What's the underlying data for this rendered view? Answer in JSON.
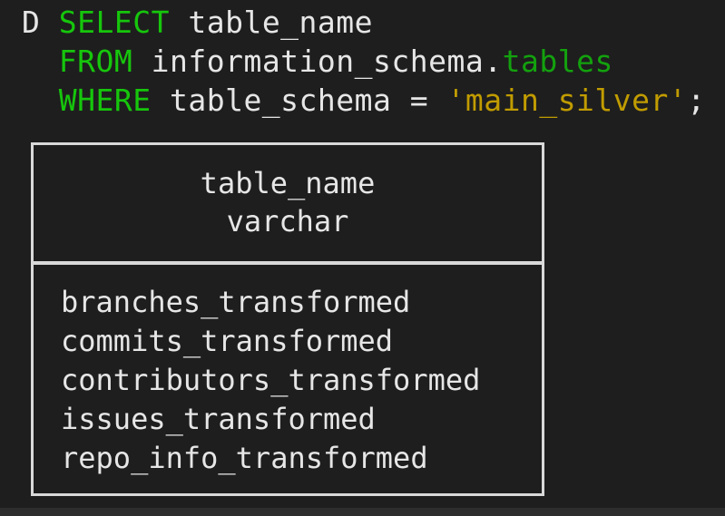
{
  "prompt": "D",
  "query": {
    "line1": {
      "keyword": "SELECT",
      "rest": "table_name"
    },
    "line2": {
      "keyword": "FROM",
      "schema": "information_schema.",
      "table": "tables"
    },
    "line3": {
      "keyword": "WHERE",
      "condition": "table_schema = ",
      "value": "'main_silver'",
      "terminator": ";"
    }
  },
  "result": {
    "column_name": "table_name",
    "column_type": "varchar",
    "rows": [
      "branches_transformed",
      "commits_transformed",
      "contributors_transformed",
      "issues_transformed",
      "repo_info_transformed"
    ]
  },
  "colors": {
    "background": "#1e1e1e",
    "keyword": "#16c60c",
    "string": "#c19c00",
    "text": "#e6e6e6",
    "border": "#d9d9d9"
  }
}
